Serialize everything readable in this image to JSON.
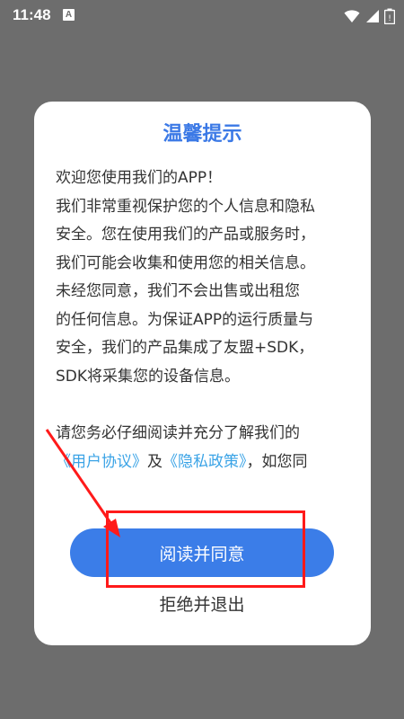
{
  "status_bar": {
    "time": "11:48",
    "badge": "A",
    "icons": [
      "wifi-icon",
      "signal-icon",
      "battery-icon"
    ]
  },
  "dialog": {
    "title": "温馨提示",
    "paragraph_1": [
      "欢迎您使用我们的APP！",
      "我们非常重视保护您的个人信息和隐私",
      "安全。您在使用我们的产品或服务时，",
      "我们可能会收集和使用您的相关信息。",
      "未经您同意，我们不会出售或出租您",
      "的任何信息。为保证APP的运行质量与",
      "安全，我们的产品集成了友盟+SDK，",
      "SDK将采集您的设备信息。"
    ],
    "paragraph_2_line_1": "请您务必仔细阅读并充分了解我们的",
    "user_agreement_link": "《用户协议》",
    "and_text": "及",
    "privacy_policy_link": "《隐私政策》",
    "paragraph_2_tail": "，如您同",
    "agree_button_label": "阅读并同意",
    "refuse_button_label": "拒绝并退出"
  },
  "colors": {
    "title": "#3b79e6",
    "primary_button": "#3b7de8",
    "link": "#3aa3e6",
    "annotation": "#ff1a1a",
    "overlay": "#6d6d6d"
  }
}
